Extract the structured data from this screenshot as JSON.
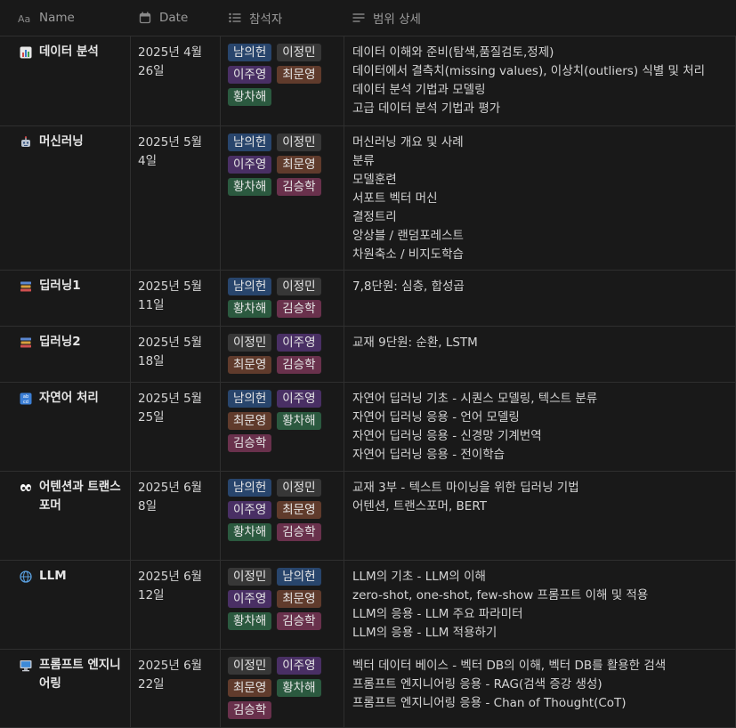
{
  "header": {
    "name": "Name",
    "date": "Date",
    "attendees": "참석자",
    "scope": "범위 상세"
  },
  "colors": {
    "blue": "#28456c",
    "gray": "#373737",
    "purple": "#492f64",
    "brown": "#603b2c",
    "green": "#2b593f",
    "pink": "#69314c"
  },
  "rows": [
    {
      "icon": "bar-chart-icon",
      "name": "데이터 분석",
      "date": "2025년 4월 26일",
      "attendees": [
        {
          "name": "남의헌",
          "color": "blue"
        },
        {
          "name": "이정민",
          "color": "gray"
        },
        {
          "name": "이주영",
          "color": "purple"
        },
        {
          "name": "최문영",
          "color": "brown"
        },
        {
          "name": "황차해",
          "color": "green"
        }
      ],
      "scope": [
        "데이터 이해와 준비(탐색,품질검토,정제)",
        "데이터에서 결측치(missing values), 이상치(outliers) 식별 및 처리",
        "데이터 분석 기법과 모델링",
        "고급 데이터 분석 기법과 평가"
      ]
    },
    {
      "icon": "robot-icon",
      "name": "머신러닝",
      "date": "2025년 5월 4일",
      "attendees": [
        {
          "name": "남의헌",
          "color": "blue"
        },
        {
          "name": "이정민",
          "color": "gray"
        },
        {
          "name": "이주영",
          "color": "purple"
        },
        {
          "name": "최문영",
          "color": "brown"
        },
        {
          "name": "황차해",
          "color": "green"
        },
        {
          "name": "김승학",
          "color": "pink"
        }
      ],
      "scope": [
        "머신러닝 개요 및 사례",
        "분류",
        "모델훈련",
        "서포트 벡터 머신",
        "결정트리",
        "앙상블 / 랜덤포레스트",
        "차원축소 / 비지도학습"
      ]
    },
    {
      "icon": "books-icon",
      "name": "딥러닝1",
      "date": "2025년 5월 11일",
      "attendees": [
        {
          "name": "남의헌",
          "color": "blue"
        },
        {
          "name": "이정민",
          "color": "gray"
        },
        {
          "name": "황차해",
          "color": "green"
        },
        {
          "name": "김승학",
          "color": "pink"
        }
      ],
      "scope": [
        "7,8단원: 심층, 합성곱"
      ]
    },
    {
      "icon": "books-icon",
      "name": "딥러닝2",
      "date": "2025년 5월 18일",
      "attendees": [
        {
          "name": "이정민",
          "color": "gray"
        },
        {
          "name": "이주영",
          "color": "purple"
        },
        {
          "name": "최문영",
          "color": "brown"
        },
        {
          "name": "김승학",
          "color": "pink"
        }
      ],
      "scope": [
        "교재 9단원: 순환, LSTM"
      ]
    },
    {
      "icon": "abcd-icon",
      "name": "자연어 처리",
      "date": "2025년 5월 25일",
      "attendees": [
        {
          "name": "남의헌",
          "color": "blue"
        },
        {
          "name": "이주영",
          "color": "purple"
        },
        {
          "name": "최문영",
          "color": "brown"
        },
        {
          "name": "황차해",
          "color": "green"
        },
        {
          "name": "김승학",
          "color": "pink"
        }
      ],
      "scope": [
        "자연어 딥러닝 기초 - 시퀀스 모델링, 텍스트 분류",
        "자연어 딥러닝 응용 - 언어 모델링",
        "자연어 딥러닝 응용 - 신경망 기계번역",
        "자연어 딥러닝 응용 - 전이학습"
      ]
    },
    {
      "icon": "eyes-icon",
      "name": "어텐션과 트랜스포머",
      "date": "2025년 6월 8일",
      "attendees": [
        {
          "name": "남의헌",
          "color": "blue"
        },
        {
          "name": "이정민",
          "color": "gray"
        },
        {
          "name": "이주영",
          "color": "purple"
        },
        {
          "name": "최문영",
          "color": "brown"
        },
        {
          "name": "황차해",
          "color": "green"
        },
        {
          "name": "김승학",
          "color": "pink"
        }
      ],
      "scope": [
        "교재 3부 - 텍스트 마이닝을 위한 딥러닝 기법",
        "어텐션, 트랜스포머, BERT"
      ]
    },
    {
      "icon": "globe-icon",
      "name": "LLM",
      "date": "2025년 6월 12일",
      "attendees": [
        {
          "name": "이정민",
          "color": "gray"
        },
        {
          "name": "남의헌",
          "color": "blue"
        },
        {
          "name": "이주영",
          "color": "purple"
        },
        {
          "name": "최문영",
          "color": "brown"
        },
        {
          "name": "황차해",
          "color": "green"
        },
        {
          "name": "김승학",
          "color": "pink"
        }
      ],
      "scope": [
        "LLM의 기초 - LLM의 이해",
        "zero-shot, one-shot, few-show 프롬프트 이해 및 적용",
        "LLM의 응용 - LLM 주요 파라미터",
        "LLM의 응용 - LLM 적용하기"
      ]
    },
    {
      "icon": "computer-icon",
      "name": "프롬프트 엔지니어링",
      "date": "2025년 6월 22일",
      "attendees": [
        {
          "name": "이정민",
          "color": "gray"
        },
        {
          "name": "이주영",
          "color": "purple"
        },
        {
          "name": "최문영",
          "color": "brown"
        },
        {
          "name": "황차해",
          "color": "green"
        },
        {
          "name": "김승학",
          "color": "pink"
        }
      ],
      "scope": [
        "벡터 데이터 베이스 - 벡터 DB의 이해, 벡터 DB를 활용한 검색",
        "프롬프트 엔지니어링 응용 - RAG(검색 증강 생성)",
        "프롬프트 엔지니어링 응용 - Chan of Thought(CoT)"
      ]
    }
  ]
}
